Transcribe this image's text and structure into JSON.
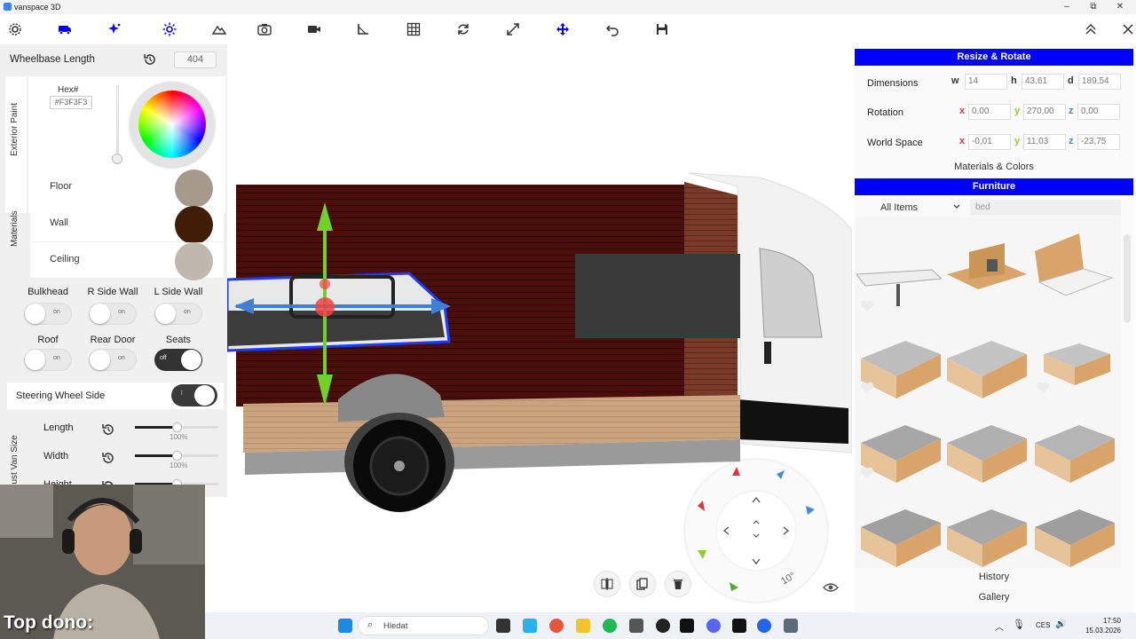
{
  "window": {
    "title": "vanspace 3D",
    "controls": [
      "–",
      "⧉",
      "✕"
    ]
  },
  "toolbar": {
    "tools": [
      "gear-icon",
      "van-icon",
      "sparkle-icon",
      "sun-icon",
      "mountain-icon",
      "camera-icon",
      "video-icon",
      "ruler-icon",
      "grid-icon",
      "rotate-icon",
      "expand-icon",
      "move-icon",
      "undo-icon",
      "save-icon"
    ],
    "active_color": "#0000ff"
  },
  "left": {
    "wheelbase_label": "Wheelbase Length",
    "wheelbase_value": "404",
    "exterior_paint_label": "Exterior Paint",
    "hex_label": "Hex#",
    "hex_value": "#F3F3F3",
    "materials_label": "Materials",
    "materials": [
      {
        "label": "Floor",
        "color": "#a69a8d"
      },
      {
        "label": "Wall",
        "color": "#3f1d06"
      },
      {
        "label": "Ceiling",
        "color": "#c0b8ae"
      }
    ],
    "toggles": [
      {
        "label": "Bulkhead",
        "state": "on"
      },
      {
        "label": "R Side Wall",
        "state": "on"
      },
      {
        "label": "L Side Wall",
        "state": "on"
      },
      {
        "label": "Roof",
        "state": "on"
      },
      {
        "label": "Rear Door",
        "state": "on"
      },
      {
        "label": "Seats",
        "state": "off"
      }
    ],
    "steering_label": "Steering Wheel Side",
    "steering_state": "l",
    "adjust_label": "Adjust Van Size",
    "sizes": [
      {
        "label": "Length",
        "pct": "100%",
        "level": 0.5
      },
      {
        "label": "Width",
        "pct": "100%",
        "level": 0.5
      },
      {
        "label": "Height",
        "pct": "",
        "level": 0.5
      }
    ]
  },
  "right": {
    "resize_title": "Resize & Rotate",
    "dimensions_label": "Dimensions",
    "dim_w": "14",
    "dim_h": "43,61",
    "dim_d": "189,54",
    "rotation_label": "Rotation",
    "rot_x": "0,00",
    "rot_y": "270,00",
    "rot_z": "0,00",
    "world_label": "World Space",
    "ws_x": "-0,01",
    "ws_y": "11,03",
    "ws_z": "-23,75",
    "axes": {
      "w": "w",
      "h": "h",
      "d": "d",
      "x": "x",
      "y": "y",
      "z": "z"
    },
    "materials_colors": "Materials & Colors",
    "furniture_title": "Furniture",
    "filter_value": "All Items",
    "search_placeholder": "bed",
    "history": "History",
    "gallery": "Gallery"
  },
  "viewport": {
    "rotate_step": "10°",
    "object_buttons": [
      "mirror-icon",
      "duplicate-icon",
      "trash-icon"
    ],
    "view_icon": "eye-icon"
  },
  "webcam": {
    "overlay_text": "Top dono:"
  },
  "taskbar": {
    "search_label": "Hledat",
    "language": "CES",
    "time": "17:50",
    "date": "15.03.2026"
  }
}
